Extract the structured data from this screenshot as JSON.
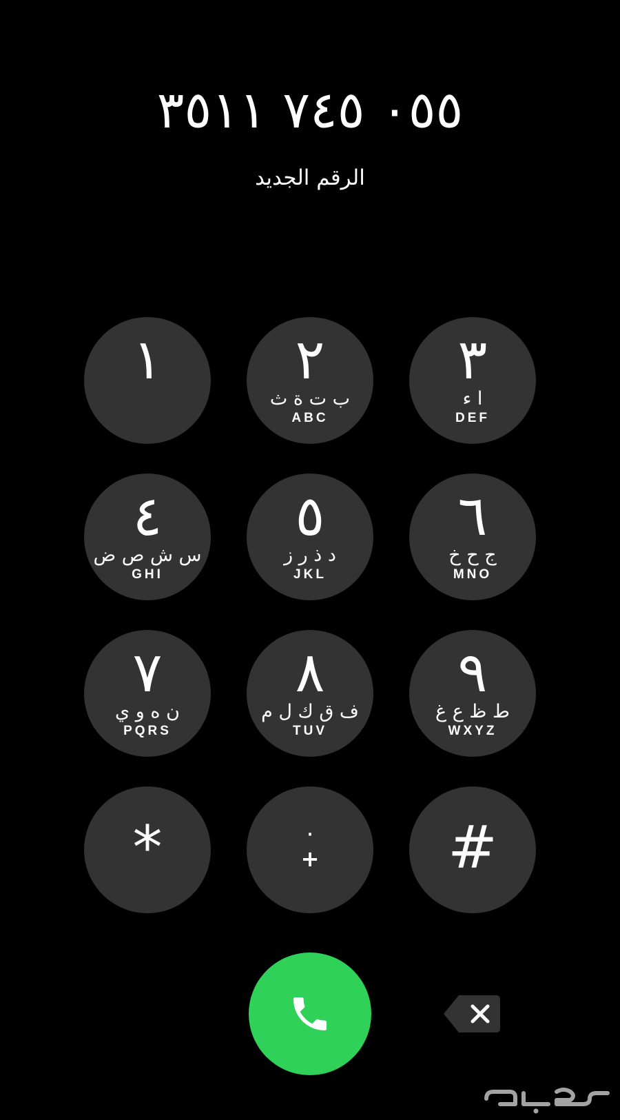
{
  "dialer": {
    "number": "٠٥٥ ٧٤٥ ٣٥١١",
    "status": "الرقم الجديد"
  },
  "keypad": {
    "keys": [
      {
        "digit": "١",
        "arabic": "",
        "latin": ""
      },
      {
        "digit": "٢",
        "arabic": "ب ت ة ث",
        "latin": "ABC"
      },
      {
        "digit": "٣",
        "arabic": "ا ء",
        "latin": "DEF"
      },
      {
        "digit": "٤",
        "arabic": "س ش ص ض",
        "latin": "GHI"
      },
      {
        "digit": "٥",
        "arabic": "د ذ ر ز",
        "latin": "JKL"
      },
      {
        "digit": "٦",
        "arabic": "ج ح خ",
        "latin": "MNO"
      },
      {
        "digit": "٧",
        "arabic": "ن ه و ي",
        "latin": "PQRS"
      },
      {
        "digit": "٨",
        "arabic": "ف ق ك ل م",
        "latin": "TUV"
      },
      {
        "digit": "٩",
        "arabic": "ط ظ ع غ",
        "latin": "WXYZ"
      },
      {
        "digit": "*",
        "arabic": "",
        "latin": ""
      },
      {
        "digit": "٠",
        "sub": "+"
      },
      {
        "digit": "#",
        "arabic": "",
        "latin": ""
      }
    ]
  },
  "actions": {
    "call_icon": "phone-icon",
    "call_color": "#30d158",
    "delete_icon": "backspace-icon"
  },
  "watermark": {
    "text": "حراج"
  },
  "colors": {
    "background": "#000000",
    "key_background": "#333333",
    "text": "#ffffff"
  }
}
